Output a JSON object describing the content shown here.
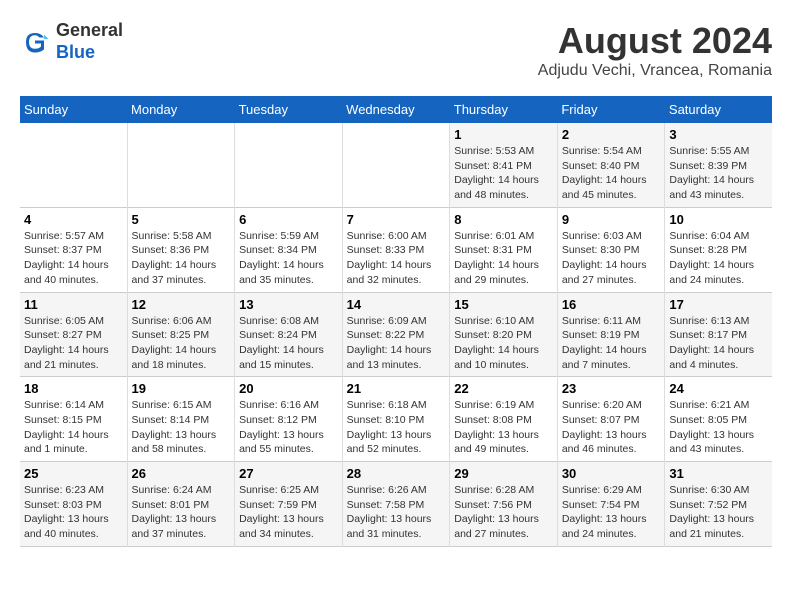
{
  "header": {
    "logo_general": "General",
    "logo_blue": "Blue",
    "month_year": "August 2024",
    "location": "Adjudu Vechi, Vrancea, Romania"
  },
  "days_of_week": [
    "Sunday",
    "Monday",
    "Tuesday",
    "Wednesday",
    "Thursday",
    "Friday",
    "Saturday"
  ],
  "weeks": [
    [
      {
        "day": "",
        "info": ""
      },
      {
        "day": "",
        "info": ""
      },
      {
        "day": "",
        "info": ""
      },
      {
        "day": "",
        "info": ""
      },
      {
        "day": "1",
        "info": "Sunrise: 5:53 AM\nSunset: 8:41 PM\nDaylight: 14 hours\nand 48 minutes."
      },
      {
        "day": "2",
        "info": "Sunrise: 5:54 AM\nSunset: 8:40 PM\nDaylight: 14 hours\nand 45 minutes."
      },
      {
        "day": "3",
        "info": "Sunrise: 5:55 AM\nSunset: 8:39 PM\nDaylight: 14 hours\nand 43 minutes."
      }
    ],
    [
      {
        "day": "4",
        "info": "Sunrise: 5:57 AM\nSunset: 8:37 PM\nDaylight: 14 hours\nand 40 minutes."
      },
      {
        "day": "5",
        "info": "Sunrise: 5:58 AM\nSunset: 8:36 PM\nDaylight: 14 hours\nand 37 minutes."
      },
      {
        "day": "6",
        "info": "Sunrise: 5:59 AM\nSunset: 8:34 PM\nDaylight: 14 hours\nand 35 minutes."
      },
      {
        "day": "7",
        "info": "Sunrise: 6:00 AM\nSunset: 8:33 PM\nDaylight: 14 hours\nand 32 minutes."
      },
      {
        "day": "8",
        "info": "Sunrise: 6:01 AM\nSunset: 8:31 PM\nDaylight: 14 hours\nand 29 minutes."
      },
      {
        "day": "9",
        "info": "Sunrise: 6:03 AM\nSunset: 8:30 PM\nDaylight: 14 hours\nand 27 minutes."
      },
      {
        "day": "10",
        "info": "Sunrise: 6:04 AM\nSunset: 8:28 PM\nDaylight: 14 hours\nand 24 minutes."
      }
    ],
    [
      {
        "day": "11",
        "info": "Sunrise: 6:05 AM\nSunset: 8:27 PM\nDaylight: 14 hours\nand 21 minutes."
      },
      {
        "day": "12",
        "info": "Sunrise: 6:06 AM\nSunset: 8:25 PM\nDaylight: 14 hours\nand 18 minutes."
      },
      {
        "day": "13",
        "info": "Sunrise: 6:08 AM\nSunset: 8:24 PM\nDaylight: 14 hours\nand 15 minutes."
      },
      {
        "day": "14",
        "info": "Sunrise: 6:09 AM\nSunset: 8:22 PM\nDaylight: 14 hours\nand 13 minutes."
      },
      {
        "day": "15",
        "info": "Sunrise: 6:10 AM\nSunset: 8:20 PM\nDaylight: 14 hours\nand 10 minutes."
      },
      {
        "day": "16",
        "info": "Sunrise: 6:11 AM\nSunset: 8:19 PM\nDaylight: 14 hours\nand 7 minutes."
      },
      {
        "day": "17",
        "info": "Sunrise: 6:13 AM\nSunset: 8:17 PM\nDaylight: 14 hours\nand 4 minutes."
      }
    ],
    [
      {
        "day": "18",
        "info": "Sunrise: 6:14 AM\nSunset: 8:15 PM\nDaylight: 14 hours\nand 1 minute."
      },
      {
        "day": "19",
        "info": "Sunrise: 6:15 AM\nSunset: 8:14 PM\nDaylight: 13 hours\nand 58 minutes."
      },
      {
        "day": "20",
        "info": "Sunrise: 6:16 AM\nSunset: 8:12 PM\nDaylight: 13 hours\nand 55 minutes."
      },
      {
        "day": "21",
        "info": "Sunrise: 6:18 AM\nSunset: 8:10 PM\nDaylight: 13 hours\nand 52 minutes."
      },
      {
        "day": "22",
        "info": "Sunrise: 6:19 AM\nSunset: 8:08 PM\nDaylight: 13 hours\nand 49 minutes."
      },
      {
        "day": "23",
        "info": "Sunrise: 6:20 AM\nSunset: 8:07 PM\nDaylight: 13 hours\nand 46 minutes."
      },
      {
        "day": "24",
        "info": "Sunrise: 6:21 AM\nSunset: 8:05 PM\nDaylight: 13 hours\nand 43 minutes."
      }
    ],
    [
      {
        "day": "25",
        "info": "Sunrise: 6:23 AM\nSunset: 8:03 PM\nDaylight: 13 hours\nand 40 minutes."
      },
      {
        "day": "26",
        "info": "Sunrise: 6:24 AM\nSunset: 8:01 PM\nDaylight: 13 hours\nand 37 minutes."
      },
      {
        "day": "27",
        "info": "Sunrise: 6:25 AM\nSunset: 7:59 PM\nDaylight: 13 hours\nand 34 minutes."
      },
      {
        "day": "28",
        "info": "Sunrise: 6:26 AM\nSunset: 7:58 PM\nDaylight: 13 hours\nand 31 minutes."
      },
      {
        "day": "29",
        "info": "Sunrise: 6:28 AM\nSunset: 7:56 PM\nDaylight: 13 hours\nand 27 minutes."
      },
      {
        "day": "30",
        "info": "Sunrise: 6:29 AM\nSunset: 7:54 PM\nDaylight: 13 hours\nand 24 minutes."
      },
      {
        "day": "31",
        "info": "Sunrise: 6:30 AM\nSunset: 7:52 PM\nDaylight: 13 hours\nand 21 minutes."
      }
    ]
  ]
}
